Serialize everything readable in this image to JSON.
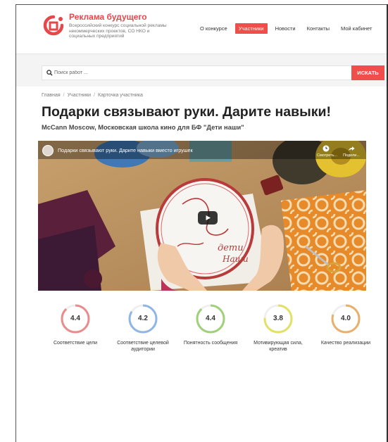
{
  "header": {
    "brand_title": "Реклама будущего",
    "brand_subtitle": "Всероссийский конкурс социальной рекламы некоммерческих проектов, СО НКО и социальных предприятий",
    "nav": [
      {
        "label": "О конкурсе",
        "active": false
      },
      {
        "label": "Участники",
        "active": true
      },
      {
        "label": "Новости",
        "active": false
      },
      {
        "label": "Контакты",
        "active": false
      },
      {
        "label": "Мой кабинет",
        "active": false
      }
    ],
    "accent_color": "#f04e4b"
  },
  "search": {
    "placeholder": "Поиск работ ...",
    "value": "",
    "button_label": "ИСКАТЬ"
  },
  "breadcrumb": [
    "Главная",
    "Участники",
    "Карточка участника"
  ],
  "page": {
    "title": "Подарки связывают руки. Дарите навыки!",
    "subtitle": "McCann Moscow, Московская школа кино для БФ \"Дети наши\""
  },
  "video": {
    "title": "Подарки связывают руки. Дарите навыки вместо игрушек",
    "watch_later_label": "Смотреть...",
    "share_label": "Подели...",
    "hoop_text_line1": "дети",
    "hoop_text_line2": "Наши"
  },
  "ratings": [
    {
      "value": "4.4",
      "score": 4.4,
      "label": "Соответствие цели",
      "color": "#ea8c8c"
    },
    {
      "value": "4.2",
      "score": 4.2,
      "label": "Соответствие целевой аудитории",
      "color": "#8fb7e3"
    },
    {
      "value": "4.4",
      "score": 4.4,
      "label": "Понятность сообщения",
      "color": "#9fd07a"
    },
    {
      "value": "3.8",
      "score": 3.8,
      "label": "Мотивирующая сила, креатив",
      "color": "#e3e066"
    },
    {
      "value": "4.0",
      "score": 4.0,
      "label": "Качество реализации",
      "color": "#e8b06a"
    }
  ]
}
